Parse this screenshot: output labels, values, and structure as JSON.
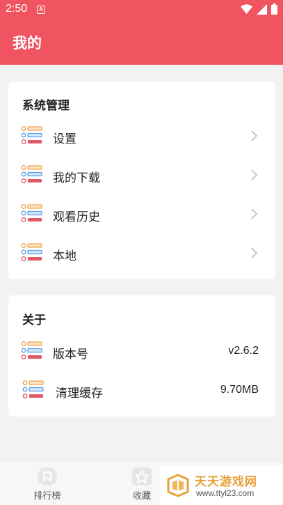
{
  "status_bar": {
    "time": "2:50",
    "notification_icon": "a-icon",
    "icons": [
      "wifi-icon",
      "signal-icon",
      "battery-icon"
    ]
  },
  "app_bar": {
    "title": "我的",
    "background": "#ef5460"
  },
  "system_section": {
    "title": "系统管理",
    "items": [
      {
        "label": "设置",
        "icon": "list-icon",
        "action_icon": "chevron-right-icon"
      },
      {
        "label": "我的下载",
        "icon": "list-icon",
        "action_icon": "chevron-right-icon"
      },
      {
        "label": "观看历史",
        "icon": "list-icon",
        "action_icon": "chevron-right-icon"
      },
      {
        "label": "本地",
        "icon": "list-icon",
        "action_icon": "chevron-right-icon"
      }
    ]
  },
  "about_section": {
    "title": "关于",
    "items": [
      {
        "label": "版本号",
        "value": "v2.6.2",
        "icon": "list-icon"
      },
      {
        "label": "清理缓存",
        "value": "9.70MB",
        "icon": "list-icon"
      }
    ]
  },
  "bottom_nav": {
    "items": [
      {
        "label": "排行榜",
        "icon": "ranking-icon"
      },
      {
        "label": "收藏",
        "icon": "favorites-icon"
      }
    ]
  },
  "watermark": {
    "title": "天天游戏网",
    "url": "www.ttyl23.com"
  },
  "colors": {
    "accent": "#ef5460",
    "icon_orange": "#f0a34a",
    "icon_blue": "#5aa0e6",
    "icon_red": "#e05a6a"
  }
}
